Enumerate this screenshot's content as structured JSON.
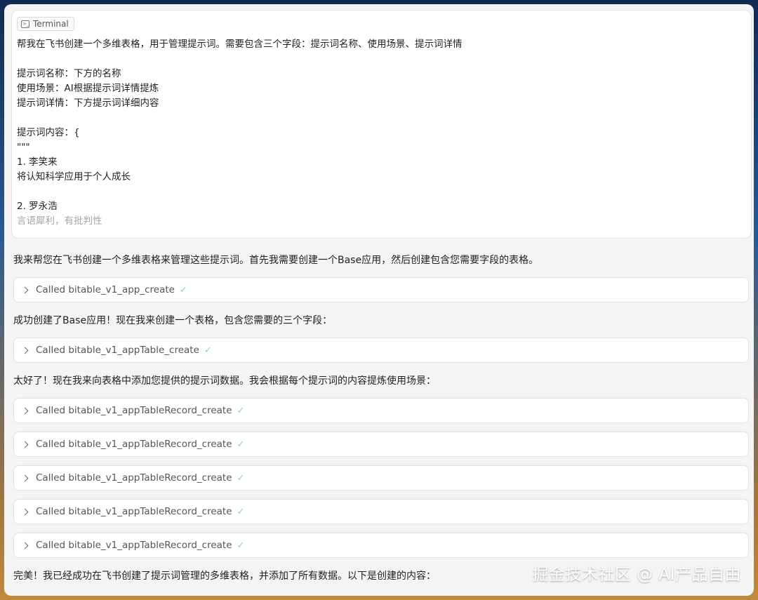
{
  "terminal_chip": {
    "label": "Terminal",
    "icon": "terminal-icon"
  },
  "prompt": {
    "lines": [
      "帮我在飞书创建一个多维表格，用于管理提示词。需要包含三个字段：提示词名称、使用场景、提示词详情",
      "",
      "提示词名称：下方的名称",
      "使用场景：AI根据提示词详情提炼",
      "提示词详情：下方提示词详细内容",
      "",
      "提示词内容：{",
      "\"\"\"",
      "1. 李笑来",
      "将认知科学应用于个人成长",
      "",
      "2. 罗永浩",
      "言语犀利，有批判性"
    ]
  },
  "messages": {
    "m1": "我来帮您在飞书创建一个多维表格来管理这些提示词。首先我需要创建一个Base应用，然后创建包含您需要字段的表格。",
    "m2": "成功创建了Base应用！现在我来创建一个表格，包含您需要的三个字段：",
    "m3": "太好了！现在我来向表格中添加您提供的提示词数据。我会根据每个提示词的内容提炼使用场景：",
    "m4": "完美！我已经成功在飞书创建了提示词管理的多维表格，并添加了所有数据。以下是创建的内容："
  },
  "tool_calls": [
    {
      "label": "Called bitable_v1_app_create",
      "status": "✓"
    },
    {
      "label": "Called bitable_v1_appTable_create",
      "status": "✓"
    },
    {
      "label": "Called bitable_v1_appTableRecord_create",
      "status": "✓"
    },
    {
      "label": "Called bitable_v1_appTableRecord_create",
      "status": "✓"
    },
    {
      "label": "Called bitable_v1_appTableRecord_create",
      "status": "✓"
    },
    {
      "label": "Called bitable_v1_appTableRecord_create",
      "status": "✓"
    },
    {
      "label": "Called bitable_v1_appTableRecord_create",
      "status": "✓"
    }
  ],
  "watermark": "掘金技术社区 @ AI产品自由",
  "colors": {
    "check": "#8fd0b0",
    "text": "#1f1f1f",
    "tool_text": "#555555",
    "panel_bg": "#f4f4f5"
  }
}
